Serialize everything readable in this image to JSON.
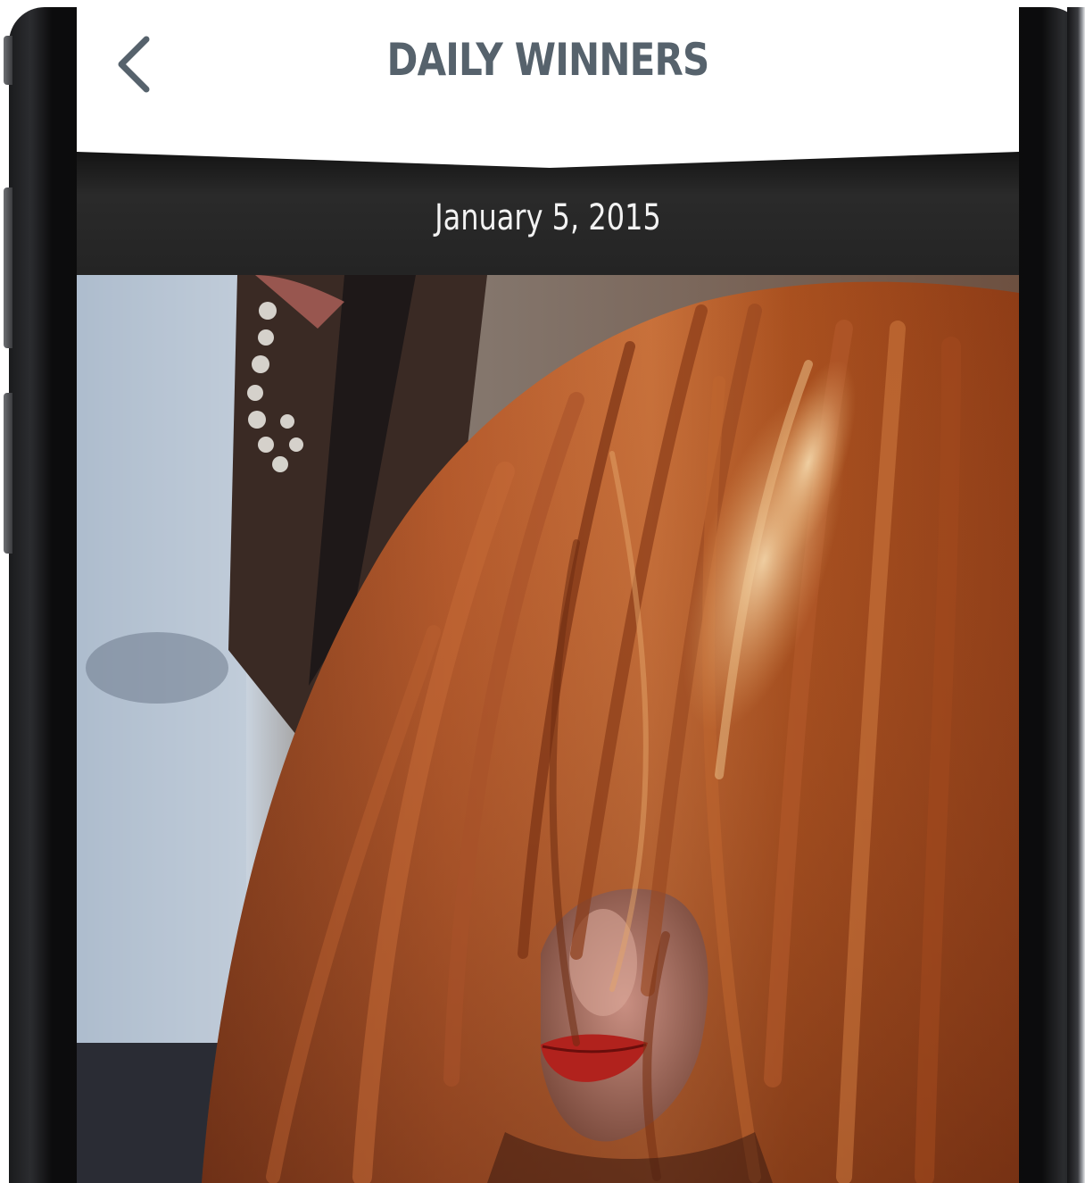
{
  "nav": {
    "title": "DAILY WINNERS",
    "back_icon": "chevron-left-icon"
  },
  "winner": {
    "date": "January 5, 2015"
  },
  "colors": {
    "title": "#56626c",
    "band": "#262626",
    "date_text": "#f2f2f2",
    "hair": "#b45a2c",
    "lips": "#b1221d"
  }
}
